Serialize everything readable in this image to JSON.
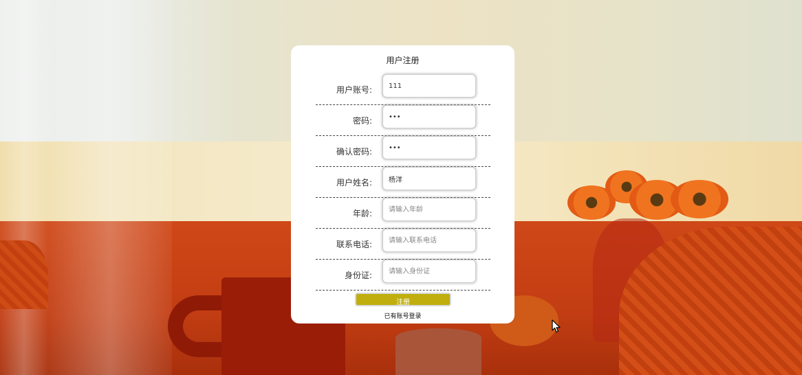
{
  "form": {
    "title": "用户注册",
    "fields": [
      {
        "label": "用户账号:",
        "value": "111",
        "placeholder": "",
        "type": "text"
      },
      {
        "label": "密码:",
        "value": "abc",
        "placeholder": "",
        "type": "password"
      },
      {
        "label": "确认密码:",
        "value": "abc",
        "placeholder": "",
        "type": "password"
      },
      {
        "label": "用户姓名:",
        "value": "杨洋",
        "placeholder": "",
        "type": "text"
      },
      {
        "label": "年龄:",
        "value": "",
        "placeholder": "请输入年龄",
        "type": "text"
      },
      {
        "label": "联系电话:",
        "value": "",
        "placeholder": "请输入联系电话",
        "type": "text"
      },
      {
        "label": "身份证:",
        "value": "",
        "placeholder": "请输入身份证",
        "type": "text"
      }
    ],
    "submit_label": "注册",
    "login_link": "已有账号登录"
  },
  "colors": {
    "button": "#bfae0d",
    "card": "#ffffff",
    "background_accent": "#c23d12"
  },
  "icons": {
    "cursor": "mouse-pointer-icon"
  }
}
